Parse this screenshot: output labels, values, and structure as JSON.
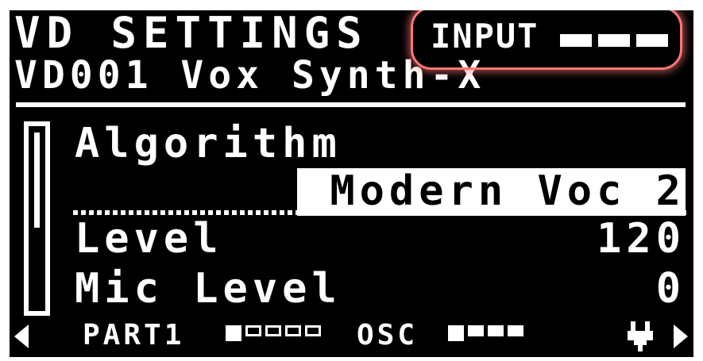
{
  "header": {
    "title": "VD SETTINGS",
    "patch": "VD001 Vox Synth-X",
    "input_label": "INPUT"
  },
  "params": [
    {
      "label": "Algorithm",
      "value": "Modern Voc 2"
    },
    {
      "label": "Level",
      "value": "120"
    },
    {
      "label": "Mic Level",
      "value": "0"
    }
  ],
  "footer": {
    "part_label": "PART1",
    "osc_label": "OSC",
    "icons": [
      "left-arrow-icon",
      "plug-icon",
      "right-arrow-icon"
    ]
  },
  "colors": {
    "background": "#000000",
    "foreground": "#ffffff",
    "highlight_ring": "#ff7676"
  }
}
